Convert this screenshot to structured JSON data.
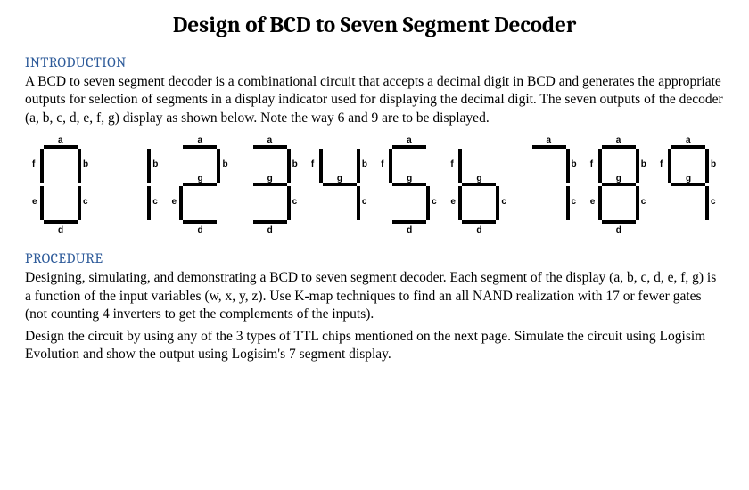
{
  "title": "Design of BCD to Seven Segment Decoder",
  "intro": {
    "heading": "INTRODUCTION",
    "p1": "A BCD to seven segment decoder is a combinational circuit that accepts a decimal digit in BCD and generates the appropriate outputs for selection of segments in a display indicator used for displaying the decimal digit.  The seven outputs of the decoder (a, b, c, d, e, f, g) display as shown below. Note the way 6 and 9 are to be displayed."
  },
  "procedure": {
    "heading": "PROCEDURE",
    "p1": "Designing, simulating, and demonstrating a BCD to seven segment decoder.  Each segment of the display (a, b, c, d, e, f, g) is a function of the input variables (w, x, y, z). Use K-map techniques to find an all NAND realization with 17 or fewer gates (not counting 4 inverters to get the complements of the inputs).",
    "p2": "Design the circuit by using any of the 3 types of TTL chips mentioned on the next page.  Simulate the circuit using Logisim Evolution and show the output using Logisim's 7 segment display."
  },
  "digits": [
    {
      "value": 0,
      "segments": [
        "a",
        "b",
        "c",
        "d",
        "e",
        "f"
      ]
    },
    {
      "value": 1,
      "segments": [
        "b",
        "c"
      ]
    },
    {
      "value": 2,
      "segments": [
        "a",
        "b",
        "g",
        "e",
        "d"
      ]
    },
    {
      "value": 3,
      "segments": [
        "a",
        "b",
        "g",
        "c",
        "d"
      ]
    },
    {
      "value": 4,
      "segments": [
        "f",
        "g",
        "b",
        "c"
      ]
    },
    {
      "value": 5,
      "segments": [
        "a",
        "f",
        "g",
        "c",
        "d"
      ]
    },
    {
      "value": 6,
      "segments": [
        "f",
        "g",
        "e",
        "c",
        "d"
      ]
    },
    {
      "value": 7,
      "segments": [
        "a",
        "b",
        "c"
      ]
    },
    {
      "value": 8,
      "segments": [
        "a",
        "b",
        "c",
        "d",
        "e",
        "f",
        "g"
      ]
    },
    {
      "value": 9,
      "segments": [
        "a",
        "b",
        "c",
        "f",
        "g"
      ]
    }
  ],
  "segment_labels": {
    "a": "a",
    "b": "b",
    "c": "c",
    "d": "d",
    "e": "e",
    "f": "f",
    "g": "g"
  }
}
